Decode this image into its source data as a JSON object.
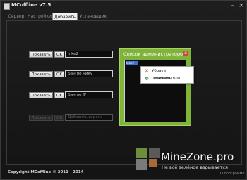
{
  "app": {
    "title": "MCoffline v7.5"
  },
  "window_controls": {
    "minimize": "–",
    "close": "×"
  },
  "tabs": [
    {
      "label": "Сервер",
      "active": false
    },
    {
      "label": "Настройки",
      "active": false
    },
    {
      "label": "Добавить",
      "active": true
    },
    {
      "label": "Установщик",
      "active": false
    }
  ],
  "rows": [
    {
      "show_label": "Показать",
      "ok_label": "OK",
      "value": "Inke2",
      "disabled": false
    },
    {
      "show_label": "Показать",
      "ok_label": "OK",
      "value": "Бан по нику",
      "disabled": false
    },
    {
      "show_label": "Показать",
      "ok_label": "OK",
      "value": "Бан по IP",
      "disabled": false
    },
    {
      "show_label": "Показать",
      "ok_label": "OK",
      "value": "Добавить игрока",
      "disabled": true
    }
  ],
  "admin_dialog": {
    "title": "Список администраторов",
    "close_label": "x",
    "list_items": [
      "Inke2"
    ]
  },
  "context_menu": {
    "items": [
      {
        "label": "Убрать пользователя",
        "icon": "red-x-icon"
      },
      {
        "label": "Обновить",
        "icon": "refresh-icon"
      }
    ]
  },
  "footer": {
    "copyright": "Copyright MCoffline © 2011 - 2014",
    "about": "О программе"
  },
  "watermark": {
    "title": "MineZone.pro",
    "tagline": "Не всё зелёное взрывается"
  },
  "colors": {
    "accent": "#7fb33a",
    "window_bg": "#1a1a1a",
    "selection": "#3d6fd6"
  }
}
